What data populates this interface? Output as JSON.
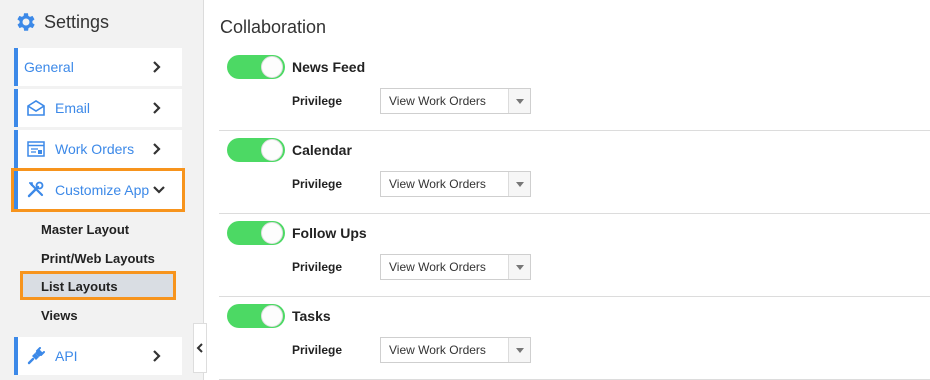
{
  "sidebar": {
    "title": "Settings",
    "items": [
      {
        "label": "General",
        "icon": "none"
      },
      {
        "label": "Email",
        "icon": "envelope-icon"
      },
      {
        "label": "Work Orders",
        "icon": "work-orders-icon"
      },
      {
        "label": "Customize App",
        "icon": "tools-icon",
        "expanded": true
      },
      {
        "label": "API",
        "icon": "plug-icon"
      }
    ],
    "sub_items": [
      "Master Layout",
      "Print/Web Layouts",
      "List Layouts",
      "Views"
    ],
    "selected_sub_item": "List Layouts"
  },
  "main": {
    "section_title": "Collaboration",
    "rows": [
      {
        "title": "News Feed",
        "enabled": true,
        "privilege_label": "Privilege",
        "privilege_value": "View Work Orders"
      },
      {
        "title": "Calendar",
        "enabled": true,
        "privilege_label": "Privilege",
        "privilege_value": "View Work Orders"
      },
      {
        "title": "Follow Ups",
        "enabled": true,
        "privilege_label": "Privilege",
        "privilege_value": "View Work Orders"
      },
      {
        "title": "Tasks",
        "enabled": true,
        "privilege_label": "Privilege",
        "privilege_value": "View Work Orders"
      }
    ]
  },
  "colors": {
    "accent_blue": "#3c89e8",
    "toggle_on": "#4cd964",
    "highlight_orange": "#f7941d"
  }
}
